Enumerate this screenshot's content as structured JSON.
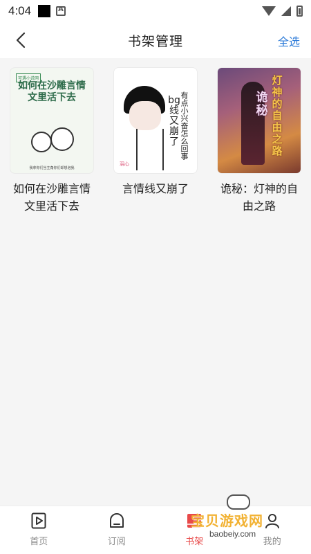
{
  "status_bar": {
    "time": "4:04"
  },
  "header": {
    "title": "书架管理",
    "select_all_label": "全选",
    "back_icon": "back-arrow-icon"
  },
  "books": [
    {
      "title": "如何在沙雕言情文里活下去",
      "cover": {
        "tag": "可遇小说网",
        "headline": "如何在沙雕言情文里活下去",
        "footer": "我拿你们当主角你们却想泡我"
      }
    },
    {
      "title": "言情线又崩了",
      "cover": {
        "side_text": "有点小兴奋怎么回事",
        "main_text": "bg线又崩了",
        "stamp": "羽心"
      }
    },
    {
      "title": "诡秘：灯神的自由之路",
      "cover": {
        "main_text": "灯神的自由之路",
        "side_text": "诡秘"
      }
    }
  ],
  "bottom_nav": [
    {
      "label": "首页",
      "icon": "play-book-icon",
      "active": false
    },
    {
      "label": "订阅",
      "icon": "home-bag-icon",
      "active": false
    },
    {
      "label": "书架",
      "icon": "bookshelf-icon",
      "active": true
    },
    {
      "label": "我的",
      "icon": "user-icon",
      "active": false
    }
  ],
  "watermark": {
    "text": "宝贝游戏网",
    "url": "baobeiy.com"
  },
  "colors": {
    "accent_blue": "#2d7bd8",
    "active_red": "#e84a4a",
    "background": "#f5f5f5"
  }
}
